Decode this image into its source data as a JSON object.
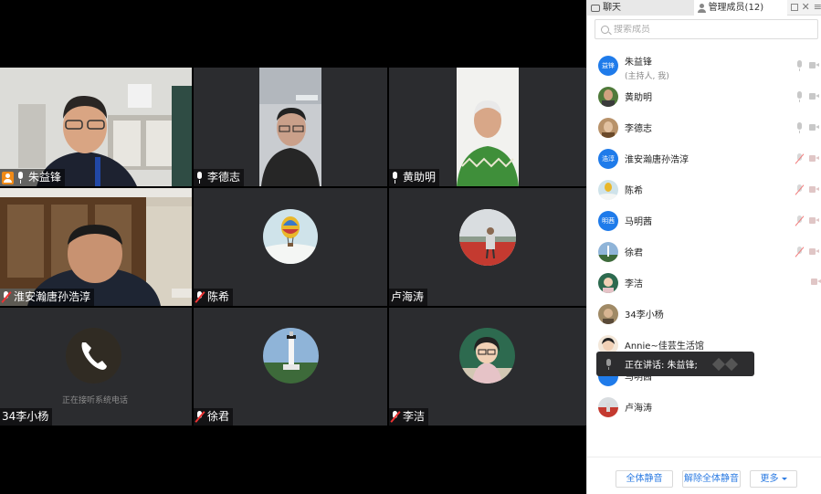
{
  "video": {
    "tiles": [
      {
        "name": "朱益锋",
        "host": true,
        "mic": "on",
        "active": true
      },
      {
        "name": "李德志",
        "host": false,
        "mic": "on"
      },
      {
        "name": "黄助明",
        "host": false,
        "mic": "on"
      },
      {
        "name": "淮安瀚唐孙浩淳",
        "host": false,
        "mic": "off"
      },
      {
        "name": "陈希",
        "host": false,
        "mic": "off"
      },
      {
        "name": "卢海涛",
        "host": false,
        "mic": "none"
      },
      {
        "name": "34李小杨",
        "host": false,
        "mic": "none",
        "status": "正在接听系统电话"
      },
      {
        "name": "徐君",
        "host": false,
        "mic": "off"
      },
      {
        "name": "李洁",
        "host": false,
        "mic": "off"
      }
    ]
  },
  "panel": {
    "tabs": {
      "chat": "聊天",
      "members": "管理成员(12)"
    },
    "search_placeholder": "搜索成员",
    "members": [
      {
        "name": "朱益锋",
        "sub": "(主持人, 我)",
        "avatar_text": "益锋",
        "avatar_color": "#1f7bea",
        "mic": "gray",
        "cam": "gray"
      },
      {
        "name": "黄助明",
        "mic": "gray",
        "cam": "gray"
      },
      {
        "name": "李德志",
        "mic": "gray",
        "cam": "gray"
      },
      {
        "name": "淮安瀚唐孙浩淳",
        "avatar_text": "浩淳",
        "avatar_color": "#1f7bea",
        "mic": "muted",
        "cam": "off"
      },
      {
        "name": "陈希",
        "mic": "muted",
        "cam": "off"
      },
      {
        "name": "马明茜",
        "avatar_text": "明茜",
        "avatar_color": "#1f7bea",
        "mic": "muted",
        "cam": "off"
      },
      {
        "name": "徐君",
        "mic": "muted",
        "cam": "off"
      },
      {
        "name": "李洁",
        "mic": "muted",
        "cam": "none"
      },
      {
        "name": "34李小杨",
        "mic": "none",
        "cam": "none"
      },
      {
        "name": "Annie~佳芸生活馆",
        "mic": "none",
        "cam": "none"
      },
      {
        "name": "马明茜",
        "avatar_color": "#1f7bea",
        "mic": "none",
        "cam": "none"
      },
      {
        "name": "卢海涛",
        "mic": "none",
        "cam": "none"
      }
    ],
    "tooltip": "正在讲话: 朱益锋;",
    "footer": {
      "mute_all": "全体静音",
      "unmute_all": "解除全体静音",
      "more": "更多"
    }
  },
  "colors": {
    "accent": "#2a7ae2",
    "active_border": "#22b14c",
    "host_badge": "#f08a16",
    "muted": "#f27a7a"
  }
}
